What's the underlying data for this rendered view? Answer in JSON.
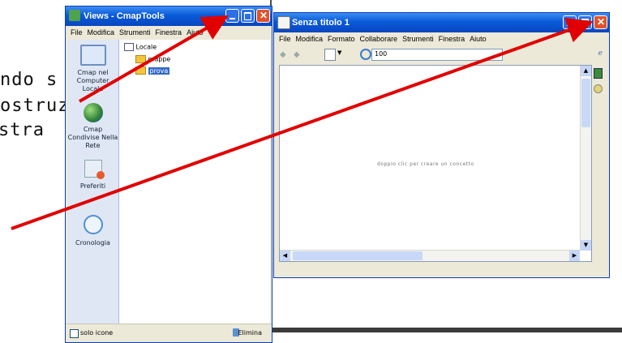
{
  "slide": {
    "lines": [
      "ndo s",
      "ostruz",
      "stra"
    ]
  },
  "views_window": {
    "title": "Views - CmapTools",
    "menu": [
      "File",
      "Modifica",
      "Strumenti",
      "Finestra",
      "Aiuto"
    ],
    "sidebar": [
      {
        "label": "Cmap nel Computer Locale",
        "icon": "computer-icon"
      },
      {
        "label": "Cmap Condivise Nella Rete",
        "icon": "globe-icon"
      },
      {
        "label": "Preferiti",
        "icon": "favorites-icon"
      },
      {
        "label": "Cronologia",
        "icon": "history-icon"
      }
    ],
    "tree_root": "Locale",
    "folders": [
      "mappe",
      "prova"
    ],
    "footer_checkbox": "solo icone",
    "footer_delete": "Elimina"
  },
  "editor_window": {
    "title": "Senza titolo 1",
    "menu": [
      "File",
      "Modifica",
      "Formato",
      "Collaborare",
      "Strumenti",
      "Finestra",
      "Aiuto"
    ],
    "zoom": "100",
    "canvas_hint": "doppio clic per creare un concetto"
  },
  "colors": {
    "arrow": "#e00000",
    "titlebar": "#0a5ad8",
    "close": "#e0532a"
  }
}
